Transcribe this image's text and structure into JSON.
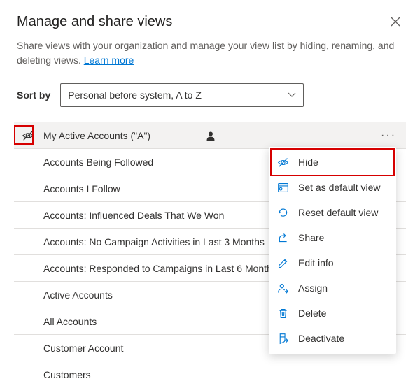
{
  "header": {
    "title": "Manage and share views",
    "subtitle_pre": "Share views with your organization and manage your view list by hiding, renaming, and deleting views. ",
    "learn_more": "Learn more"
  },
  "sort": {
    "label": "Sort by",
    "selected": "Personal before system, A to Z"
  },
  "views": [
    {
      "name": "My Active Accounts (\"A\")",
      "is_current": true,
      "has_personal_icon": true
    },
    {
      "name": "Accounts Being Followed"
    },
    {
      "name": "Accounts I Follow"
    },
    {
      "name": "Accounts: Influenced Deals That We Won"
    },
    {
      "name": "Accounts: No Campaign Activities in Last 3 Months"
    },
    {
      "name": "Accounts: Responded to Campaigns in Last 6 Months"
    },
    {
      "name": "Active Accounts"
    },
    {
      "name": "All Accounts"
    },
    {
      "name": "Customer Account"
    },
    {
      "name": "Customers"
    }
  ],
  "menu": [
    {
      "icon": "hide-icon",
      "label": "Hide"
    },
    {
      "icon": "default-icon",
      "label": "Set as default view"
    },
    {
      "icon": "reset-icon",
      "label": "Reset default view"
    },
    {
      "icon": "share-icon",
      "label": "Share"
    },
    {
      "icon": "edit-icon",
      "label": "Edit info"
    },
    {
      "icon": "assign-icon",
      "label": "Assign"
    },
    {
      "icon": "delete-icon",
      "label": "Delete"
    },
    {
      "icon": "deactivate-icon",
      "label": "Deactivate"
    }
  ]
}
